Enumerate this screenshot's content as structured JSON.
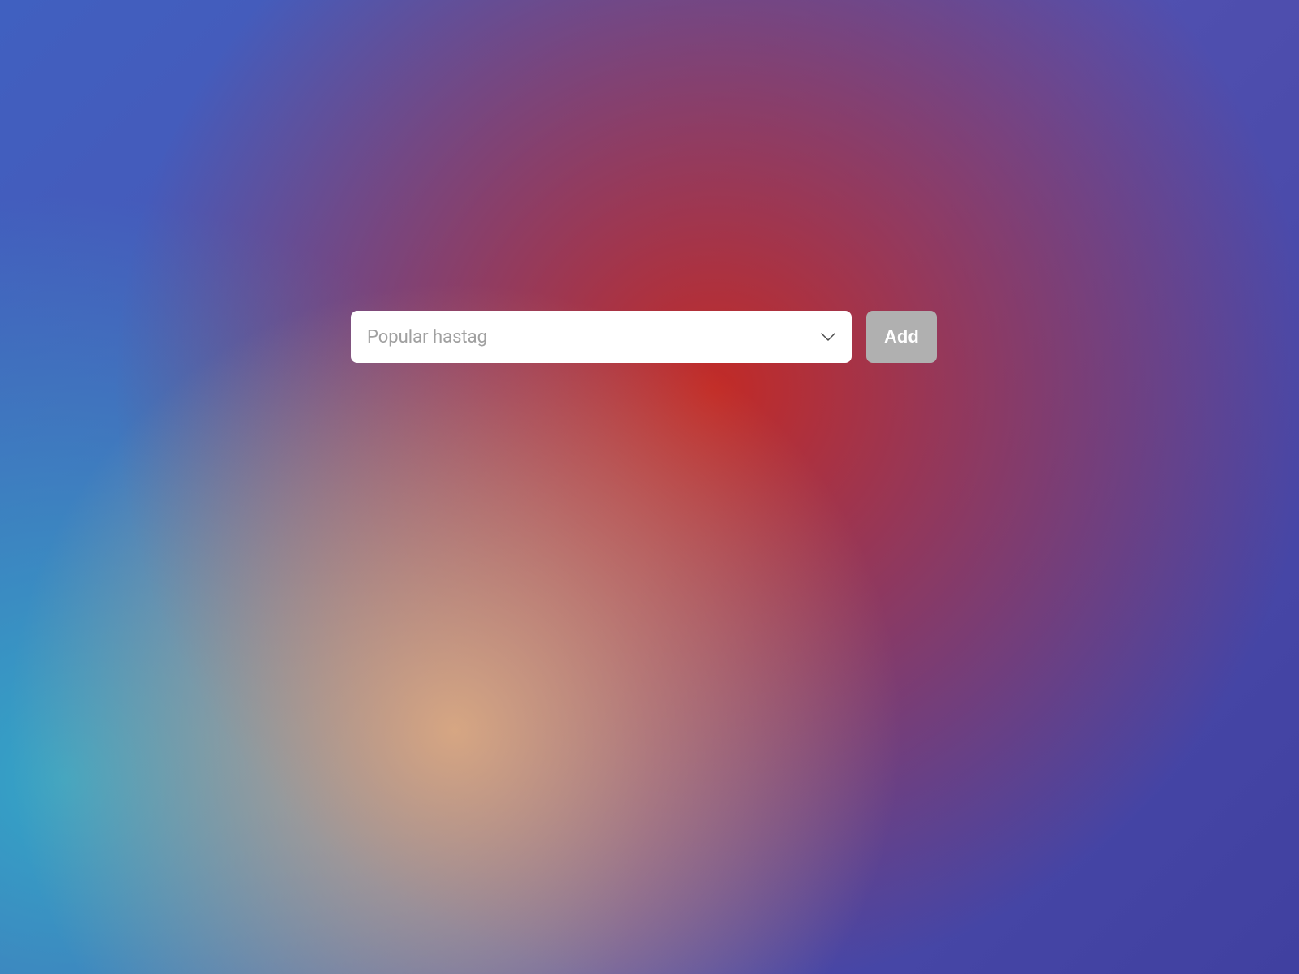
{
  "form": {
    "select": {
      "placeholder": "Popular hastag",
      "value": ""
    },
    "addButton": {
      "label": "Add"
    }
  }
}
